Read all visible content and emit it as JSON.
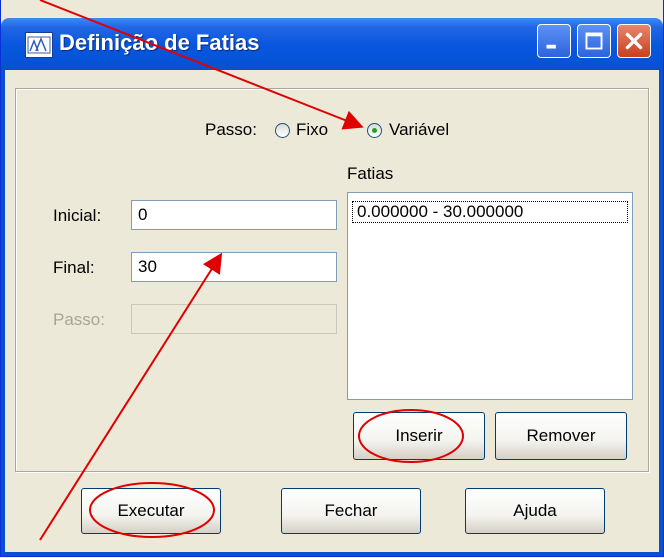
{
  "window": {
    "title": "Definição de Fatias",
    "controls": [
      "minimize-icon",
      "maximize-icon",
      "close-icon"
    ]
  },
  "passo_mode": {
    "label": "Passo:",
    "options": [
      {
        "label": "Fixo",
        "checked": false
      },
      {
        "label": "Variável",
        "checked": true
      }
    ]
  },
  "fields": {
    "inicial": {
      "label": "Inicial:",
      "value": "0"
    },
    "final": {
      "label": "Final:",
      "value": "30"
    },
    "passo": {
      "label": "Passo:",
      "value": "",
      "disabled": true
    }
  },
  "fatias": {
    "label": "Fatias",
    "items": [
      "0.000000 - 30.000000"
    ]
  },
  "buttons": {
    "inserir": "Inserir",
    "remover": "Remover",
    "executar": "Executar",
    "fechar": "Fechar",
    "ajuda": "Ajuda"
  },
  "annotation_color": "#e00000"
}
